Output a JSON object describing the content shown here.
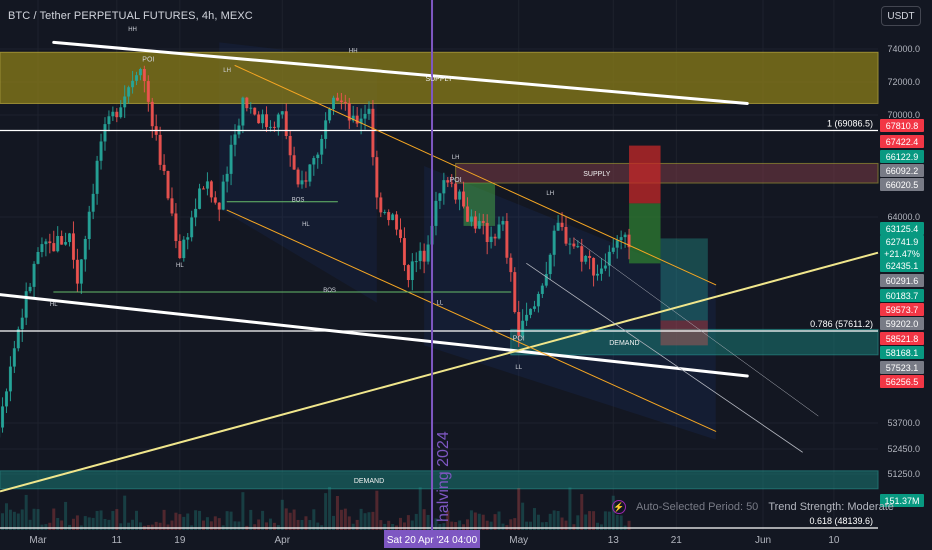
{
  "header": {
    "title": "BTC / Tether PERPETUAL FUTURES, 4h, MEXC",
    "currency_button": "USDT"
  },
  "indicator": {
    "period_label": "Auto-Selected Period: 50",
    "strength_label": "Trend Strength: Moderate"
  },
  "halving_label": "halving 2024",
  "colors": {
    "background": "#131722",
    "up": "#26a69a",
    "down": "#ef5350",
    "halving_line": "#7e57c2",
    "trend_yellow": "#f0e68c",
    "supply_zone": "#b7a72c",
    "demand_zone": "#26a69a",
    "channel_orange": "#f5a623"
  },
  "chart_data": {
    "type": "candlestick",
    "symbol": "BTC / Tether PERPETUAL FUTURES",
    "interval": "4h",
    "exchange": "MEXC",
    "y_range": [
      49500,
      75500
    ],
    "y_ticks": [
      74000,
      72000,
      70000,
      64000,
      53700,
      52450,
      51250
    ],
    "x_range": [
      "2024-02-23",
      "2024-06-10"
    ],
    "x_ticks": [
      {
        "date": "2024-03-01",
        "label": "Mar"
      },
      {
        "date": "2024-03-11",
        "label": "11"
      },
      {
        "date": "2024-03-19",
        "label": "19"
      },
      {
        "date": "2024-04-01",
        "label": "Apr"
      },
      {
        "date": "2024-04-20",
        "label": "Sat 20 Apr '24   04:00",
        "highlight": true
      },
      {
        "date": "2024-05-01",
        "label": "May"
      },
      {
        "date": "2024-05-13",
        "label": "13"
      },
      {
        "date": "2024-05-21",
        "label": "21"
      },
      {
        "date": "2024-06-01",
        "label": "Jun"
      },
      {
        "date": "2024-06-10",
        "label": "10"
      }
    ],
    "price_path": [
      [
        "2024-02-23",
        51000
      ],
      [
        "2024-02-27",
        57000
      ],
      [
        "2024-03-01",
        62000
      ],
      [
        "2024-03-05",
        63000
      ],
      [
        "2024-03-06",
        60500
      ],
      [
        "2024-03-09",
        68500
      ],
      [
        "2024-03-14",
        73300
      ],
      [
        "2024-03-16",
        68500
      ],
      [
        "2024-03-19",
        62000
      ],
      [
        "2024-03-22",
        66000
      ],
      [
        "2024-03-24",
        64500
      ],
      [
        "2024-03-27",
        71000
      ],
      [
        "2024-03-30",
        69500
      ],
      [
        "2024-04-01",
        70000
      ],
      [
        "2024-04-03",
        65500
      ],
      [
        "2024-04-06",
        68500
      ],
      [
        "2024-04-08",
        71200
      ],
      [
        "2024-04-10",
        69500
      ],
      [
        "2024-04-12",
        70600
      ],
      [
        "2024-04-13",
        65000
      ],
      [
        "2024-04-15",
        64000
      ],
      [
        "2024-04-17",
        61000
      ],
      [
        "2024-04-19",
        62000
      ],
      [
        "2024-04-20",
        64000
      ],
      [
        "2024-04-22",
        66500
      ],
      [
        "2024-04-24",
        64500
      ],
      [
        "2024-04-27",
        63000
      ],
      [
        "2024-04-29",
        63500
      ],
      [
        "2024-05-01",
        57500
      ],
      [
        "2024-05-03",
        59000
      ],
      [
        "2024-05-06",
        63500
      ],
      [
        "2024-05-08",
        62500
      ],
      [
        "2024-05-11",
        61000
      ],
      [
        "2024-05-13",
        62000
      ],
      [
        "2024-05-15",
        62741.9
      ]
    ],
    "horizontal_levels": [
      {
        "label": "1 (69086.5)",
        "price": 69086.5
      },
      {
        "label": "0.786 (57611.2)",
        "price": 57611.2
      },
      {
        "label": "0.618 (48139.6)",
        "price": 48139.6
      }
    ],
    "zones": [
      {
        "label": "SUPPLY",
        "price_from": 70700,
        "price_to": 73800
      },
      {
        "label": "SUPPLY",
        "price_from": 66000,
        "price_to": 67150
      },
      {
        "label": "DEMAND",
        "price_from": 56600,
        "price_to": 57700
      },
      {
        "label": "DEMAND",
        "price_from": 50400,
        "price_to": 51400
      }
    ],
    "annotations": [
      "HH",
      "POI",
      "LH",
      "HH",
      "HL",
      "BOS",
      "HL",
      "HL",
      "BOS",
      "LL",
      "LH",
      "POI",
      "LH",
      "POI",
      "LL"
    ],
    "price_labels": [
      {
        "value": "67810.8",
        "color": "#f23645"
      },
      {
        "value": "67422.4",
        "color": "#f23645"
      },
      {
        "value": "66122.9",
        "color": "#089981"
      },
      {
        "value": "66092.2",
        "color": "#787b86"
      },
      {
        "value": "66020.5",
        "color": "#787b86"
      },
      {
        "value": "63125.4",
        "color": "#089981"
      },
      {
        "value": "62741.9",
        "color": "#089981",
        "extra": [
          "+21.47%",
          "01:02:28"
        ]
      },
      {
        "value": "62435.1",
        "color": "#089981"
      },
      {
        "value": "60291.6",
        "color": "#787b86"
      },
      {
        "value": "60183.7",
        "color": "#089981"
      },
      {
        "value": "59573.7",
        "color": "#f23645"
      },
      {
        "value": "59202.0",
        "color": "#787b86"
      },
      {
        "value": "58521.8",
        "color": "#f23645"
      },
      {
        "value": "58168.1",
        "color": "#089981"
      },
      {
        "value": "57523.1",
        "color": "#787b86"
      },
      {
        "value": "56256.5",
        "color": "#f23645"
      },
      {
        "value": "151.37M",
        "color": "#089981"
      }
    ]
  }
}
